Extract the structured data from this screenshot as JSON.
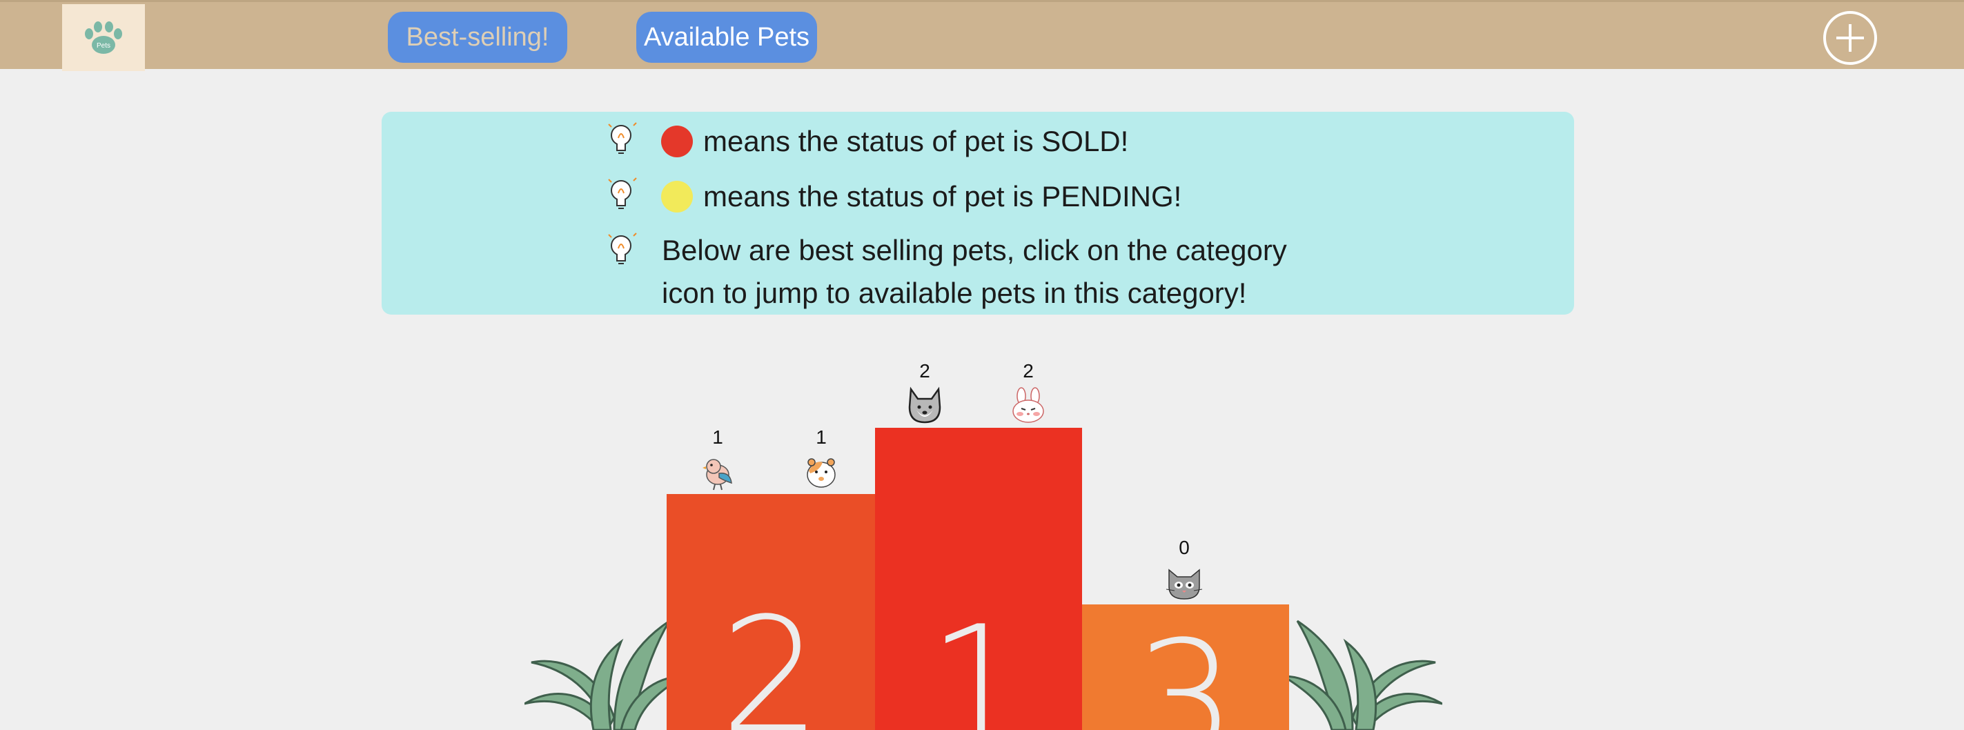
{
  "nav": {
    "logo_text": "Pets",
    "best_selling_label": "Best-selling!",
    "available_pets_label": "Available Pets"
  },
  "tips": {
    "sold_text": "means the status of pet is SOLD!",
    "pending_text": "means the status of pet is PENDING!",
    "below_line1": "Below are best selling pets, click on the category",
    "below_line2": "icon to jump to available pets in this category!",
    "sold_color": "#e4382a",
    "pending_color": "#f2ea5a"
  },
  "podium": {
    "first": {
      "rank": "1",
      "color": "#eb3122",
      "pets": [
        {
          "icon": "dog-icon",
          "count": "2"
        },
        {
          "icon": "rabbit-icon",
          "count": "2"
        }
      ]
    },
    "second": {
      "rank": "2",
      "color": "#ea4e27",
      "pets": [
        {
          "icon": "bird-icon",
          "count": "1"
        },
        {
          "icon": "hamster-icon",
          "count": "1"
        }
      ]
    },
    "third": {
      "rank": "3",
      "color": "#f07a30",
      "pets": [
        {
          "icon": "cat-icon",
          "count": "0"
        }
      ]
    }
  }
}
